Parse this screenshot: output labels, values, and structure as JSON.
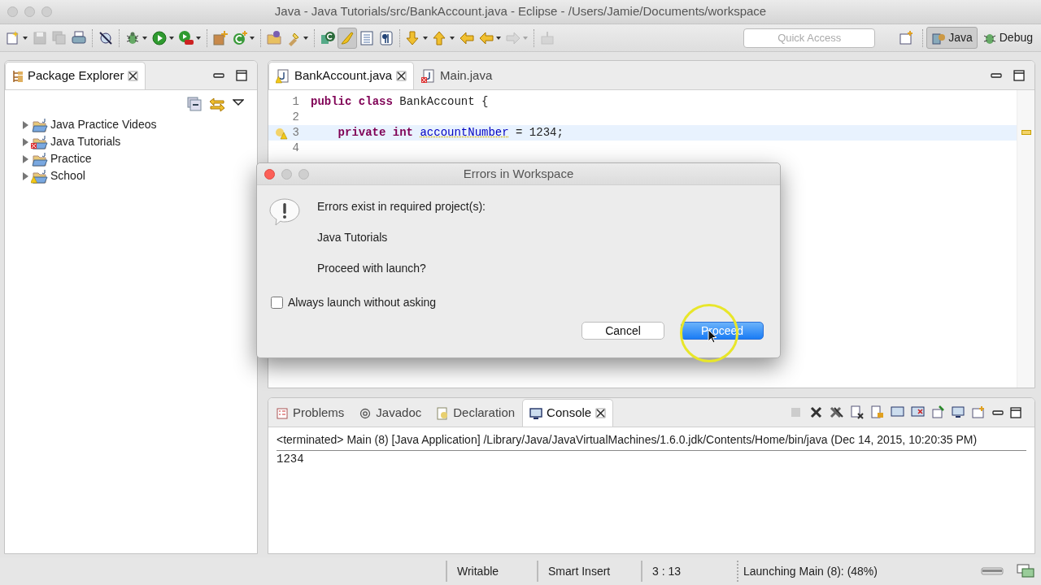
{
  "window": {
    "title": "Java - Java Tutorials/src/BankAccount.java - Eclipse - /Users/Jamie/Documents/workspace"
  },
  "toolbar": [
    {
      "kind": "new",
      "dropdown": true,
      "disabled": false,
      "selected": false
    },
    {
      "kind": "save",
      "dropdown": false,
      "disabled": true,
      "selected": false
    },
    {
      "kind": "save_all",
      "dropdown": false,
      "disabled": true,
      "selected": false
    },
    {
      "kind": "print",
      "dropdown": false,
      "disabled": false,
      "selected": false
    },
    {
      "kind": "separator"
    },
    {
      "kind": "skip_breakpoints",
      "dropdown": false,
      "disabled": false,
      "selected": false
    },
    {
      "kind": "separator"
    },
    {
      "kind": "debug",
      "dropdown": true,
      "disabled": false,
      "selected": false
    },
    {
      "kind": "run",
      "dropdown": true,
      "disabled": false,
      "selected": false
    },
    {
      "kind": "external",
      "dropdown": true,
      "disabled": false,
      "selected": false
    },
    {
      "kind": "separator"
    },
    {
      "kind": "new_package",
      "dropdown": false,
      "disabled": false,
      "selected": false
    },
    {
      "kind": "new_class",
      "dropdown": true,
      "disabled": false,
      "selected": false
    },
    {
      "kind": "separator"
    },
    {
      "kind": "open_type",
      "dropdown": false,
      "disabled": false,
      "selected": false
    },
    {
      "kind": "search",
      "dropdown": true,
      "disabled": false,
      "selected": false
    },
    {
      "kind": "separator"
    },
    {
      "kind": "open_task",
      "dropdown": false,
      "disabled": false,
      "selected": false
    },
    {
      "kind": "highlight",
      "dropdown": false,
      "disabled": false,
      "selected": true
    },
    {
      "kind": "block",
      "dropdown": false,
      "disabled": false,
      "selected": false
    },
    {
      "kind": "whitespace",
      "dropdown": false,
      "disabled": false,
      "selected": false
    },
    {
      "kind": "separator"
    },
    {
      "kind": "next",
      "dropdown": true,
      "disabled": false,
      "selected": false
    },
    {
      "kind": "prev",
      "dropdown": true,
      "disabled": false,
      "selected": false
    },
    {
      "kind": "last_edit",
      "dropdown": false,
      "disabled": false,
      "selected": false
    },
    {
      "kind": "back",
      "dropdown": true,
      "disabled": false,
      "selected": false
    },
    {
      "kind": "forward",
      "dropdown": true,
      "disabled": true,
      "selected": false
    },
    {
      "kind": "separator"
    },
    {
      "kind": "pin",
      "dropdown": false,
      "disabled": true,
      "selected": false
    }
  ],
  "quick_access": {
    "placeholder": "Quick Access"
  },
  "perspectives": [
    {
      "label": "Java",
      "selected": true
    },
    {
      "label": "Debug",
      "selected": false
    }
  ],
  "package_explorer": {
    "title": "Package Explorer",
    "items": [
      {
        "label": "Java Practice Videos",
        "expanded": false,
        "has_errors": false,
        "has_warnings": false
      },
      {
        "label": "Java Tutorials",
        "expanded": false,
        "has_errors": true,
        "has_warnings": false
      },
      {
        "label": "Practice",
        "expanded": false,
        "has_errors": false,
        "has_warnings": false
      },
      {
        "label": "School",
        "expanded": false,
        "has_errors": false,
        "has_warnings": true
      }
    ]
  },
  "editor": {
    "tabs": [
      {
        "label": "BankAccount.java",
        "selected": true,
        "has_errors": false,
        "has_warnings": true
      },
      {
        "label": "Main.java",
        "selected": false,
        "has_errors": true,
        "has_warnings": false
      }
    ],
    "lines": [
      {
        "number": "1",
        "current": false,
        "indent": false,
        "tokens": [
          {
            "kind": "keyword",
            "text": "public"
          },
          {
            "kind": "keyword",
            "text": "class"
          },
          {
            "kind": "plain",
            "text": "BankAccount {"
          }
        ]
      },
      {
        "number": "2",
        "current": false
      },
      {
        "number": "3",
        "current": true,
        "warning": true,
        "indent": true,
        "tokens": [
          {
            "kind": "keyword",
            "text": "private"
          },
          {
            "kind": "keyword",
            "text": "int"
          },
          {
            "kind": "field_warning",
            "text": "accountNumber"
          },
          {
            "kind": "plain",
            "text": "= 1234;"
          }
        ]
      },
      {
        "number": "4",
        "current": false
      }
    ]
  },
  "bottom": {
    "tabs": [
      {
        "label": "Problems",
        "selected": false,
        "kind": "problems"
      },
      {
        "label": "Javadoc",
        "selected": false,
        "kind": "javadoc"
      },
      {
        "label": "Declaration",
        "selected": false,
        "kind": "declaration"
      },
      {
        "label": "Console",
        "selected": true,
        "kind": "console"
      }
    ],
    "console_header": "<terminated> Main (8) [Java Application] /Library/Java/JavaVirtualMachines/1.6.0.jdk/Contents/Home/bin/java (Dec 14, 2015, 10:20:35 PM)",
    "console_output": [
      "1234"
    ]
  },
  "status_bar": {
    "fields": [
      "Writable",
      "Smart Insert",
      "3 : 13"
    ],
    "progress": "Launching Main (8): (48%)"
  },
  "dialog": {
    "title": "Errors in Workspace",
    "messages": [
      "Errors exist in required project(s):",
      "Java Tutorials",
      "Proceed with launch?"
    ],
    "checkbox": {
      "label": "Always launch without asking",
      "checked": false
    },
    "buttons": [
      {
        "label": "Cancel",
        "default": false
      },
      {
        "label": "Proceed",
        "default": true
      }
    ]
  }
}
